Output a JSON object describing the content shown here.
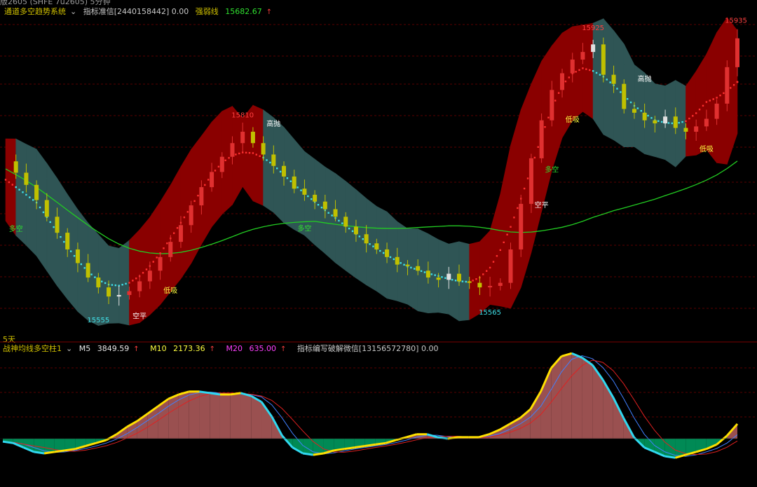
{
  "header": {
    "title": "版2605 (SHFE 7u2605) 5分钟",
    "indicator1": {
      "name": "通道多空趋势系统",
      "note": "指标准信[2440158442] 0.00",
      "line_label": "强弱线",
      "line_value": "15682.67"
    },
    "indicator2": {
      "name": "战神均线多空柱1",
      "m5_label": "M5",
      "m5_value": "3849.59",
      "m10_label": "M10",
      "m10_value": "2173.36",
      "m20_label": "M20",
      "m20_value": "635.00",
      "note": "指标编写破解微信[13156572780] 0.00"
    },
    "period_label": "5天"
  },
  "colors": {
    "background": "#000000",
    "band_bear": "#2f5555",
    "band_bull": "#8a0000",
    "mid_dots_bear": "#40e0e8",
    "mid_dots_bull": "#ff3030",
    "long_ma": "#22cc22",
    "candle_up": "#c0c000",
    "candle_down": "#e03030",
    "osc_pos": "#9a5050",
    "osc_neg": "#008a55",
    "grid": "#5a0000"
  },
  "chart_data": [
    {
      "type": "candlestick",
      "title": "",
      "price_labels": [
        {
          "text": "15810",
          "price": 15810
        },
        {
          "text": "15555",
          "price": 15555
        },
        {
          "text": "15565",
          "price": 15565
        },
        {
          "text": "15925",
          "price": 15925
        },
        {
          "text": "15935",
          "price": 15935
        }
      ],
      "signals": [
        {
          "text": "多空",
          "style": "green"
        },
        {
          "text": "低吸",
          "style": "yellow"
        },
        {
          "text": "空平",
          "style": "white"
        },
        {
          "text": "高抛",
          "style": "white"
        },
        {
          "text": "多空",
          "style": "green"
        },
        {
          "text": "多空",
          "style": "green"
        },
        {
          "text": "空平",
          "style": "white"
        },
        {
          "text": "低吸",
          "style": "yellow"
        },
        {
          "text": "高抛",
          "style": "white"
        },
        {
          "text": "低吸",
          "style": "yellow"
        }
      ],
      "ylim": [
        15520,
        15950
      ],
      "series": [
        {
          "name": "强弱线",
          "last": 15682.67
        }
      ],
      "close": [
        15756,
        15741,
        15725,
        15705,
        15683,
        15662,
        15640,
        15622,
        15603,
        15590,
        15578,
        15580,
        15585,
        15598,
        15612,
        15630,
        15650,
        15672,
        15698,
        15722,
        15742,
        15762,
        15780,
        15795,
        15780,
        15765,
        15750,
        15736,
        15720,
        15712,
        15703,
        15693,
        15683,
        15670,
        15660,
        15648,
        15640,
        15630,
        15620,
        15618,
        15612,
        15603,
        15600,
        15608,
        15598,
        15596,
        15590,
        15592,
        15596,
        15640,
        15700,
        15760,
        15810,
        15850,
        15872,
        15890,
        15900,
        15910,
        15870,
        15858,
        15825,
        15820,
        15810,
        15806,
        15815,
        15800,
        15795,
        15802,
        15812,
        15832,
        15880,
        15918
      ]
    },
    {
      "type": "area",
      "title": "",
      "series": [
        {
          "name": "M5",
          "last": 3849.59
        },
        {
          "name": "M10",
          "last": 2173.36
        },
        {
          "name": "M20",
          "last": 635.0
        }
      ],
      "values": [
        -2,
        -3,
        -6,
        -9,
        -10,
        -9,
        -8,
        -7,
        -5,
        -3,
        -1,
        3,
        8,
        12,
        17,
        22,
        27,
        30,
        32,
        32,
        31,
        30,
        30,
        31,
        29,
        25,
        15,
        2,
        -6,
        -10,
        -11,
        -10,
        -8,
        -7,
        -6,
        -5,
        -4,
        -3,
        -1,
        1,
        3,
        3,
        1,
        0,
        1,
        1,
        1,
        3,
        6,
        10,
        14,
        20,
        32,
        48,
        56,
        58,
        55,
        50,
        40,
        28,
        14,
        1,
        -6,
        -9,
        -12,
        -13,
        -11,
        -9,
        -7,
        -4,
        2,
        10
      ]
    }
  ]
}
